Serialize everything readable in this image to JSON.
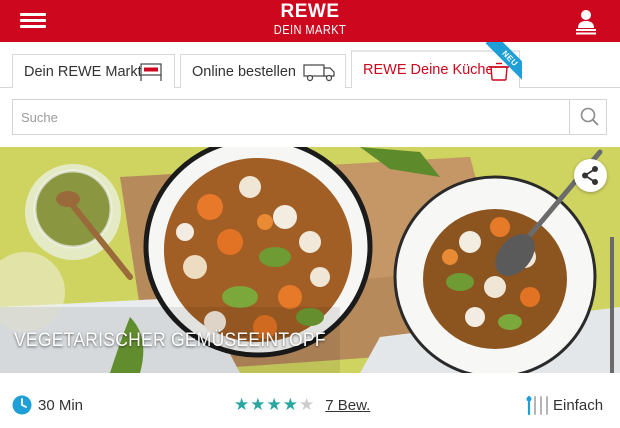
{
  "header": {
    "logo_main": "REWE",
    "logo_sub": "DEIN MARKT",
    "brand_color": "#cc071e"
  },
  "tabs": [
    {
      "label": "Dein REWE Markt",
      "icon": "rewe-store-flag-icon",
      "active": false
    },
    {
      "label": "Online bestellen",
      "icon": "delivery-truck-icon",
      "active": false
    },
    {
      "label": "REWE Deine Küche",
      "icon": "cooking-pot-icon",
      "active": true,
      "badge": "NEU"
    }
  ],
  "search": {
    "placeholder": "Suche",
    "value": "",
    "icon": "search-icon"
  },
  "hero": {
    "title": "VEGETARISCHER GEMÜSEEINTOPF",
    "share_icon": "share-icon"
  },
  "info": {
    "time": "30 Min",
    "rating": 4,
    "rating_max": 5,
    "reviews": "7 Bew.",
    "difficulty": "Einfach",
    "accent_color": "#1f9fd8",
    "star_color": "#2aa6a0",
    "star_empty_color": "#cccccc"
  }
}
